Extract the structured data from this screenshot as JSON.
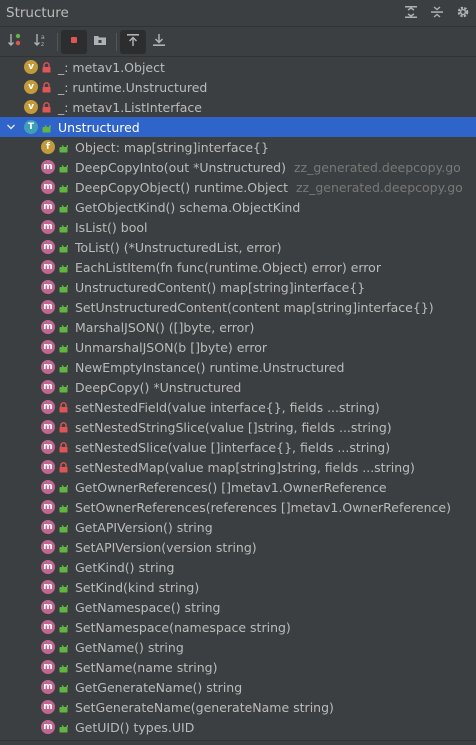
{
  "panel": {
    "title": "Structure"
  },
  "colors": {
    "method": "#c16690",
    "field": "#c29a3c",
    "var": "#c29a3c",
    "type": "#3f9fb5",
    "public_lock": "#62b543",
    "private_lock": "#e05555",
    "selected": "#2f65ca"
  },
  "title_tools": [
    {
      "icon": "expand-all-icon"
    },
    {
      "icon": "collapse-all-icon"
    },
    {
      "icon": "gear-icon"
    }
  ],
  "toolbar": [
    {
      "icon": "sort-by-visibility-icon",
      "active": false
    },
    {
      "icon": "sort-alphabetically-icon",
      "active": false
    },
    {
      "sep": true
    },
    {
      "icon": "show-fields-icon",
      "active": true
    },
    {
      "icon": "show-inherited-icon",
      "active": false
    },
    {
      "sep": true
    },
    {
      "icon": "autoscroll-to-source-icon",
      "active": true
    },
    {
      "icon": "autoscroll-from-source-icon",
      "active": false
    }
  ],
  "tree": {
    "items": [
      {
        "kind": "var",
        "letter": "v",
        "vis": "private",
        "label": "_: metav1.Object",
        "indent": 24
      },
      {
        "kind": "var",
        "letter": "v",
        "vis": "private",
        "label": "_: runtime.Unstructured",
        "indent": 24
      },
      {
        "kind": "var",
        "letter": "v",
        "vis": "private",
        "label": "_: metav1.ListInterface",
        "indent": 24
      },
      {
        "kind": "type",
        "letter": "T",
        "vis": "public",
        "label": "Unstructured",
        "indent": 24,
        "selected": true,
        "expanded": true
      },
      {
        "kind": "field",
        "letter": "f",
        "vis": "public",
        "label": "Object: map[string]interface{}",
        "indent": 41
      },
      {
        "kind": "method",
        "letter": "m",
        "vis": "public",
        "label": "DeepCopyInto(out *Unstructured)",
        "loc": "zz_generated.deepcopy.go",
        "indent": 41
      },
      {
        "kind": "method",
        "letter": "m",
        "vis": "public",
        "label": "DeepCopyObject() runtime.Object",
        "loc": "zz_generated.deepcopy.go",
        "indent": 41
      },
      {
        "kind": "method",
        "letter": "m",
        "vis": "public",
        "label": "GetObjectKind() schema.ObjectKind",
        "indent": 41
      },
      {
        "kind": "method",
        "letter": "m",
        "vis": "public",
        "label": "IsList() bool",
        "indent": 41
      },
      {
        "kind": "method",
        "letter": "m",
        "vis": "public",
        "label": "ToList() (*UnstructuredList, error)",
        "indent": 41
      },
      {
        "kind": "method",
        "letter": "m",
        "vis": "public",
        "label": "EachListItem(fn func(runtime.Object) error) error",
        "indent": 41
      },
      {
        "kind": "method",
        "letter": "m",
        "vis": "public",
        "label": "UnstructuredContent() map[string]interface{}",
        "indent": 41
      },
      {
        "kind": "method",
        "letter": "m",
        "vis": "public",
        "label": "SetUnstructuredContent(content map[string]interface{})",
        "indent": 41
      },
      {
        "kind": "method",
        "letter": "m",
        "vis": "public",
        "label": "MarshalJSON() ([]byte, error)",
        "indent": 41
      },
      {
        "kind": "method",
        "letter": "m",
        "vis": "public",
        "label": "UnmarshalJSON(b []byte) error",
        "indent": 41
      },
      {
        "kind": "method",
        "letter": "m",
        "vis": "public",
        "label": "NewEmptyInstance() runtime.Unstructured",
        "indent": 41
      },
      {
        "kind": "method",
        "letter": "m",
        "vis": "public",
        "label": "DeepCopy() *Unstructured",
        "indent": 41
      },
      {
        "kind": "method",
        "letter": "m",
        "vis": "private",
        "label": "setNestedField(value interface{}, fields ...string)",
        "indent": 41
      },
      {
        "kind": "method",
        "letter": "m",
        "vis": "private",
        "label": "setNestedStringSlice(value []string, fields ...string)",
        "indent": 41
      },
      {
        "kind": "method",
        "letter": "m",
        "vis": "private",
        "label": "setNestedSlice(value []interface{}, fields ...string)",
        "indent": 41
      },
      {
        "kind": "method",
        "letter": "m",
        "vis": "private",
        "label": "setNestedMap(value map[string]string, fields ...string)",
        "indent": 41
      },
      {
        "kind": "method",
        "letter": "m",
        "vis": "public",
        "label": "GetOwnerReferences() []metav1.OwnerReference",
        "indent": 41
      },
      {
        "kind": "method",
        "letter": "m",
        "vis": "public",
        "label": "SetOwnerReferences(references []metav1.OwnerReference)",
        "indent": 41
      },
      {
        "kind": "method",
        "letter": "m",
        "vis": "public",
        "label": "GetAPIVersion() string",
        "indent": 41
      },
      {
        "kind": "method",
        "letter": "m",
        "vis": "public",
        "label": "SetAPIVersion(version string)",
        "indent": 41
      },
      {
        "kind": "method",
        "letter": "m",
        "vis": "public",
        "label": "GetKind() string",
        "indent": 41
      },
      {
        "kind": "method",
        "letter": "m",
        "vis": "public",
        "label": "SetKind(kind string)",
        "indent": 41
      },
      {
        "kind": "method",
        "letter": "m",
        "vis": "public",
        "label": "GetNamespace() string",
        "indent": 41
      },
      {
        "kind": "method",
        "letter": "m",
        "vis": "public",
        "label": "SetNamespace(namespace string)",
        "indent": 41
      },
      {
        "kind": "method",
        "letter": "m",
        "vis": "public",
        "label": "GetName() string",
        "indent": 41
      },
      {
        "kind": "method",
        "letter": "m",
        "vis": "public",
        "label": "SetName(name string)",
        "indent": 41
      },
      {
        "kind": "method",
        "letter": "m",
        "vis": "public",
        "label": "GetGenerateName() string",
        "indent": 41
      },
      {
        "kind": "method",
        "letter": "m",
        "vis": "public",
        "label": "SetGenerateName(generateName string)",
        "indent": 41
      },
      {
        "kind": "method",
        "letter": "m",
        "vis": "public",
        "label": "GetUID() types.UID",
        "indent": 41
      }
    ]
  }
}
